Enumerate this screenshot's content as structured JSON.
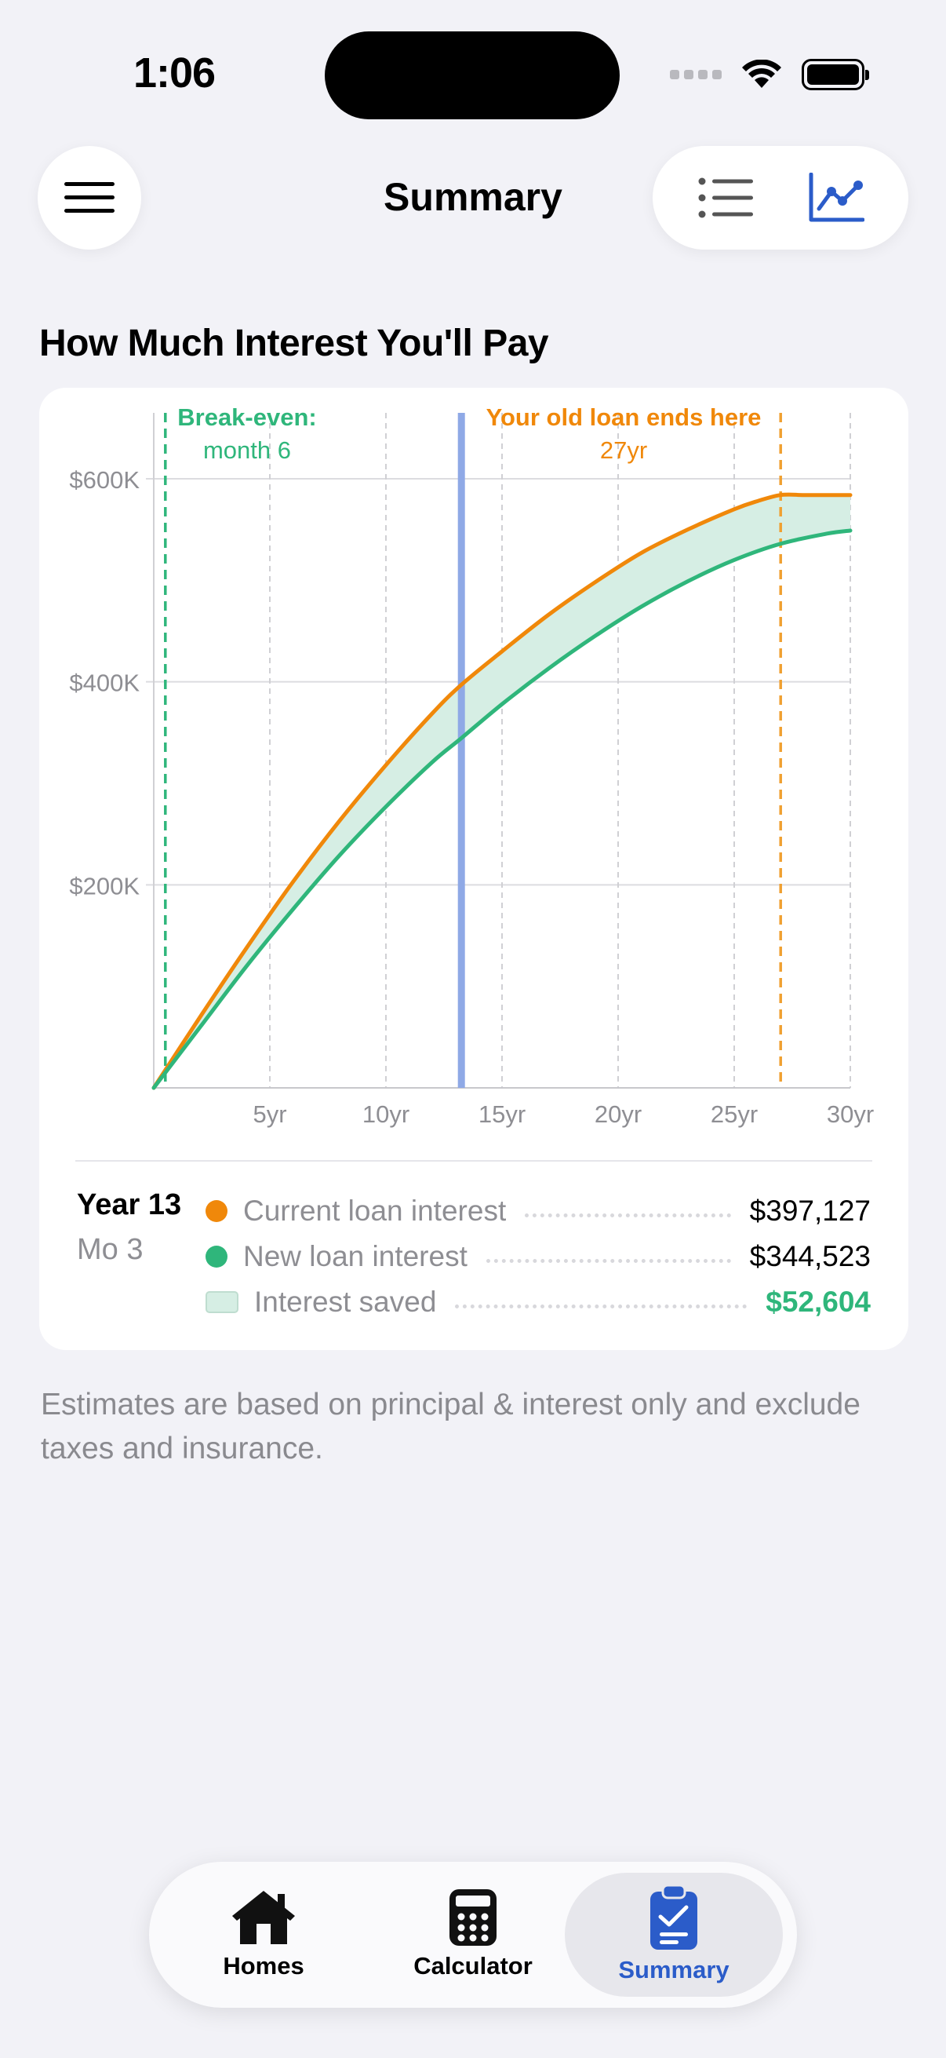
{
  "status": {
    "time": "1:06"
  },
  "nav": {
    "title": "Summary"
  },
  "section": {
    "title": "How Much Interest You'll Pay"
  },
  "colors": {
    "current": "#f0880a",
    "new": "#2fb67b",
    "saved_fill": "#d6eee4",
    "cursor": "#8fa9e6",
    "accent": "#2b5cc9"
  },
  "chart": {
    "breakeven_label": "Break-even:",
    "breakeven_sub": "month 6",
    "oldloan_label": "Your old loan ends here",
    "oldloan_sub": "27yr"
  },
  "chart_data": {
    "type": "area",
    "x_unit": "years",
    "xlim": [
      0,
      30
    ],
    "ylim": [
      0,
      600000
    ],
    "x_ticks": [
      5,
      10,
      15,
      20,
      25,
      30
    ],
    "x_tick_labels": [
      "5yr",
      "10yr",
      "15yr",
      "20yr",
      "25yr",
      "30yr"
    ],
    "y_ticks": [
      200000,
      400000,
      600000
    ],
    "y_tick_labels": [
      "$200K",
      "$400K",
      "$600K"
    ],
    "grid": true,
    "series": [
      {
        "name": "Current loan interest",
        "x": [
          0,
          2,
          4,
          6,
          8,
          10,
          12,
          13.25,
          15,
          17,
          19,
          21,
          23,
          25,
          26,
          27,
          28,
          29,
          30
        ],
        "y": [
          0,
          70000,
          138000,
          203000,
          263000,
          318000,
          369000,
          397127,
          430000,
          466000,
          498000,
          527000,
          550000,
          570000,
          578000,
          584000,
          584000,
          584000,
          584000
        ]
      },
      {
        "name": "New loan interest",
        "x": [
          0,
          2,
          4,
          6,
          8,
          10,
          12,
          13.25,
          15,
          17,
          19,
          21,
          23,
          25,
          27,
          29,
          30
        ],
        "y": [
          0,
          60000,
          120000,
          176000,
          229000,
          277000,
          321000,
          344523,
          378000,
          413000,
          445000,
          474000,
          499000,
          520000,
          536000,
          546000,
          549000
        ]
      }
    ],
    "breakeven_x": 0.5,
    "old_loan_end_x": 27,
    "cursor_x": 13.25
  },
  "legend": {
    "year": "Year 13",
    "month": "Mo 3",
    "rows": [
      {
        "label": "Current loan interest",
        "value": "$397,127"
      },
      {
        "label": "New loan interest",
        "value": "$344,523"
      },
      {
        "label": "Interest saved",
        "value": "$52,604"
      }
    ]
  },
  "footnote": "Estimates are based on principal & interest only and exclude taxes and insurance.",
  "tabs": [
    {
      "label": "Homes",
      "icon": "house-icon"
    },
    {
      "label": "Calculator",
      "icon": "calculator-icon"
    },
    {
      "label": "Summary",
      "icon": "clipboard-check-icon"
    }
  ]
}
